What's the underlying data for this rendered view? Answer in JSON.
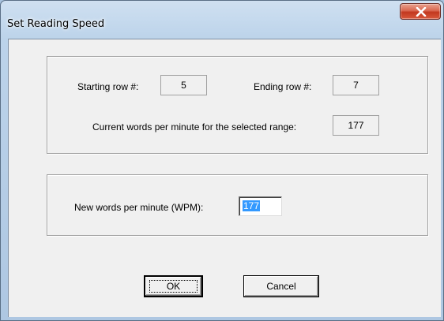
{
  "window": {
    "title": "Set Reading Speed",
    "close_icon": "close-icon"
  },
  "range_group": {
    "starting_row_label": "Starting row #:",
    "starting_row_value": "5",
    "ending_row_label": "Ending row #:",
    "ending_row_value": "7",
    "current_wpm_label": "Current words per minute for the selected range:",
    "current_wpm_value": "177"
  },
  "new_wpm_group": {
    "label": "New words per minute (WPM):",
    "value": "177"
  },
  "buttons": {
    "ok_label": "OK",
    "cancel_label": "Cancel"
  }
}
